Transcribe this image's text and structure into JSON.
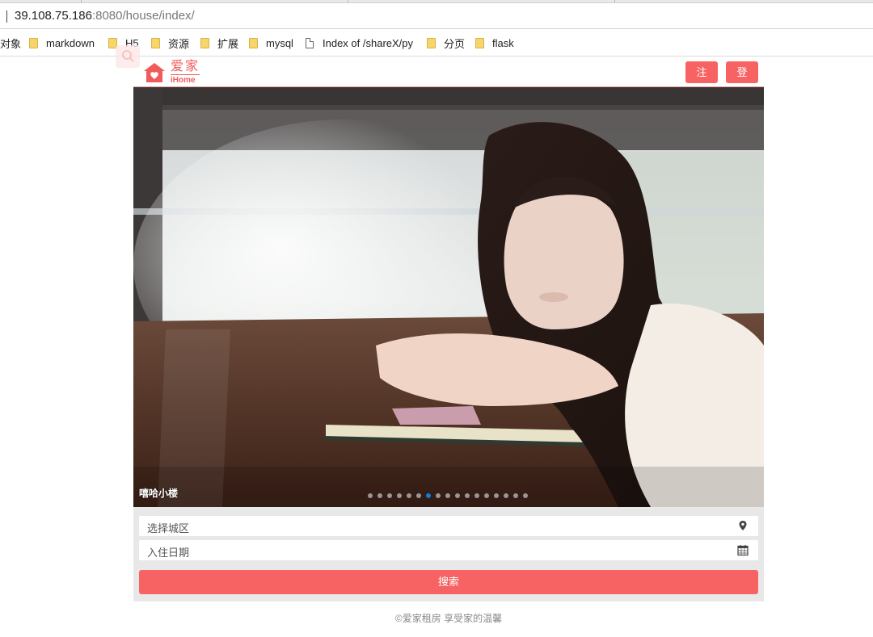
{
  "browser": {
    "url_host": "39.108.75.186",
    "url_rest": ":8080/house/index/",
    "bookmarks": [
      {
        "label": "对象",
        "icon": "none"
      },
      {
        "label": "markdown",
        "icon": "folder-icon"
      },
      {
        "label": "H5",
        "icon": "folder-icon"
      },
      {
        "label": "资源",
        "icon": "folder-icon"
      },
      {
        "label": "扩展",
        "icon": "folder-icon"
      },
      {
        "label": "mysql",
        "icon": "folder-icon"
      },
      {
        "label": "Index of /shareX/py",
        "icon": "page-icon"
      },
      {
        "label": "分页",
        "icon": "folder-icon"
      },
      {
        "label": "flask",
        "icon": "folder-icon"
      }
    ]
  },
  "header": {
    "logo_cn": "爱家",
    "logo_en": "iHome",
    "register_label": "注册",
    "login_label": "登录"
  },
  "carousel": {
    "caption": "嘻哈小楼",
    "slide_count": 17,
    "active_index": 6
  },
  "search": {
    "area_placeholder": "选择城区",
    "date_placeholder": "入住日期",
    "button_label": "搜索"
  },
  "footer": {
    "text": "©爱家租房   享受家的温馨"
  },
  "colors": {
    "brand": "#f76363",
    "logo": "#f05a5a",
    "active_dot": "#0a7de0"
  }
}
